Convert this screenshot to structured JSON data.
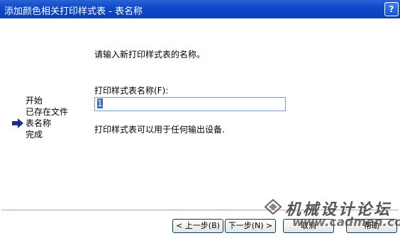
{
  "window": {
    "title": "添加颜色相关打印样式表 - 表名称",
    "help_label": "?"
  },
  "steps": {
    "items": [
      "开始",
      "已存在文件",
      "表名称",
      "完成"
    ],
    "current_index": 2
  },
  "main": {
    "prompt": "请输入新打印样式表的名称。",
    "name_label": "打印样式表名称(F):",
    "name_value": "1",
    "info": "打印样式表可以用于任何输出设备."
  },
  "buttons": {
    "back": "< 上一步(B)",
    "next": "下一步(N) >",
    "cancel": "取消",
    "help": "帮助"
  },
  "watermark": {
    "title": "机械设计论坛",
    "url": "www.cadmen.com"
  },
  "colors": {
    "titlebar": "#0a3fb8",
    "accent": "#316ac5",
    "dialog_bg": "#ece9d8"
  }
}
